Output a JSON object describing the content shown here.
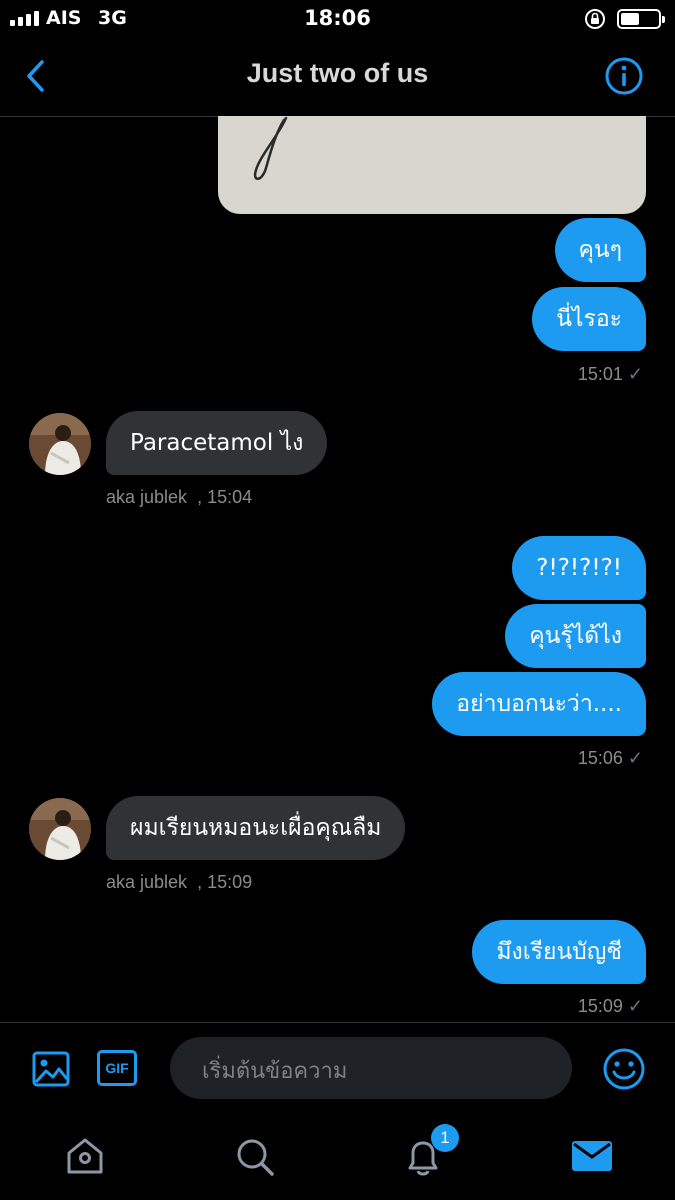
{
  "status_bar": {
    "carrier": "AIS",
    "network": "3G",
    "time": "18:06"
  },
  "header": {
    "title": "Just two of us"
  },
  "messages": [
    {
      "id": "m1",
      "text": "คุนๆ"
    },
    {
      "id": "m2",
      "text": "นี่ไรอะ"
    },
    {
      "id": "t1",
      "time": "15:01"
    },
    {
      "id": "m3",
      "text": "Paracetamol ไง"
    },
    {
      "id": "s1",
      "sender": "aka jublek",
      "time": ", 15:04"
    },
    {
      "id": "m4",
      "text": "?!?!?!?!"
    },
    {
      "id": "m5",
      "text": "คุนรุ้ได้ไง"
    },
    {
      "id": "m6",
      "text": "อย่าบอกนะว่า...."
    },
    {
      "id": "t2",
      "time": "15:06"
    },
    {
      "id": "m7",
      "text": "ผมเรียนหมอนะเผื่อคุณลืม"
    },
    {
      "id": "s2",
      "sender": "aka jublek",
      "time": ", 15:09"
    },
    {
      "id": "m8",
      "text": "มึงเรียนบัญชี"
    },
    {
      "id": "t3",
      "time": "15:09"
    }
  ],
  "composer": {
    "placeholder": "เริ่มต้นข้อความ",
    "gif_label": "GIF"
  },
  "tabbar": {
    "notification_count": "1"
  },
  "colors": {
    "accent": "#1d9bf0",
    "incoming_bubble": "#2f3336",
    "background": "#000000"
  },
  "icons": [
    "back-chevron-icon",
    "info-icon",
    "image-icon",
    "gif-icon",
    "emoji-icon",
    "home-icon",
    "search-icon",
    "bell-icon",
    "mail-icon"
  ]
}
